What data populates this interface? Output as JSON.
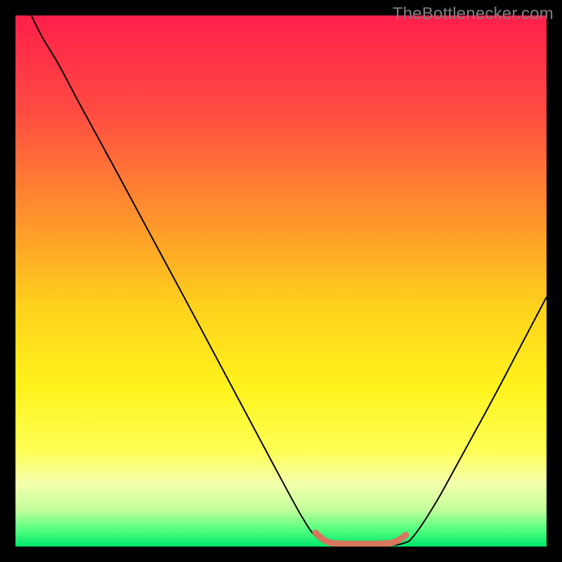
{
  "watermark": "TheBottlenecker.com",
  "chart_data": {
    "type": "line",
    "title": "",
    "xlabel": "",
    "ylabel": "",
    "xlim": [
      0,
      100
    ],
    "ylim": [
      0,
      100
    ],
    "background_gradient": {
      "stops": [
        {
          "offset": 0,
          "color": "#ff1f4a"
        },
        {
          "offset": 18,
          "color": "#ff4b42"
        },
        {
          "offset": 40,
          "color": "#ff9a2a"
        },
        {
          "offset": 55,
          "color": "#ffd21c"
        },
        {
          "offset": 70,
          "color": "#fff31c"
        },
        {
          "offset": 82,
          "color": "#feff55"
        },
        {
          "offset": 88,
          "color": "#f4ffac"
        },
        {
          "offset": 93,
          "color": "#c4ff9b"
        },
        {
          "offset": 97,
          "color": "#4fff7e"
        },
        {
          "offset": 100,
          "color": "#00e66a"
        }
      ]
    },
    "series": [
      {
        "name": "bottleneck-curve",
        "color": "#000000",
        "width": 2,
        "points": [
          {
            "x": 3.0,
            "y": 100.0
          },
          {
            "x": 5.0,
            "y": 96.0
          },
          {
            "x": 8.0,
            "y": 91.0
          },
          {
            "x": 12.0,
            "y": 83.5
          },
          {
            "x": 18.0,
            "y": 72.5
          },
          {
            "x": 25.0,
            "y": 59.5
          },
          {
            "x": 32.0,
            "y": 46.5
          },
          {
            "x": 40.0,
            "y": 31.5
          },
          {
            "x": 48.0,
            "y": 16.5
          },
          {
            "x": 54.0,
            "y": 5.5
          },
          {
            "x": 57.0,
            "y": 1.5
          },
          {
            "x": 60.0,
            "y": 0.3
          },
          {
            "x": 65.0,
            "y": 0.15
          },
          {
            "x": 70.0,
            "y": 0.2
          },
          {
            "x": 73.0,
            "y": 0.6
          },
          {
            "x": 75.0,
            "y": 2.0
          },
          {
            "x": 79.0,
            "y": 8.0
          },
          {
            "x": 84.0,
            "y": 17.0
          },
          {
            "x": 90.0,
            "y": 28.0
          },
          {
            "x": 95.0,
            "y": 37.5
          },
          {
            "x": 100.0,
            "y": 47.0
          }
        ]
      },
      {
        "name": "optimal-segment",
        "color": "#d8765f",
        "width": 9,
        "points": [
          {
            "x": 56.5,
            "y": 2.6
          },
          {
            "x": 58.5,
            "y": 1.0
          },
          {
            "x": 61.0,
            "y": 0.55
          },
          {
            "x": 65.0,
            "y": 0.5
          },
          {
            "x": 69.0,
            "y": 0.55
          },
          {
            "x": 71.5,
            "y": 0.9
          },
          {
            "x": 73.5,
            "y": 2.2
          }
        ]
      }
    ]
  }
}
